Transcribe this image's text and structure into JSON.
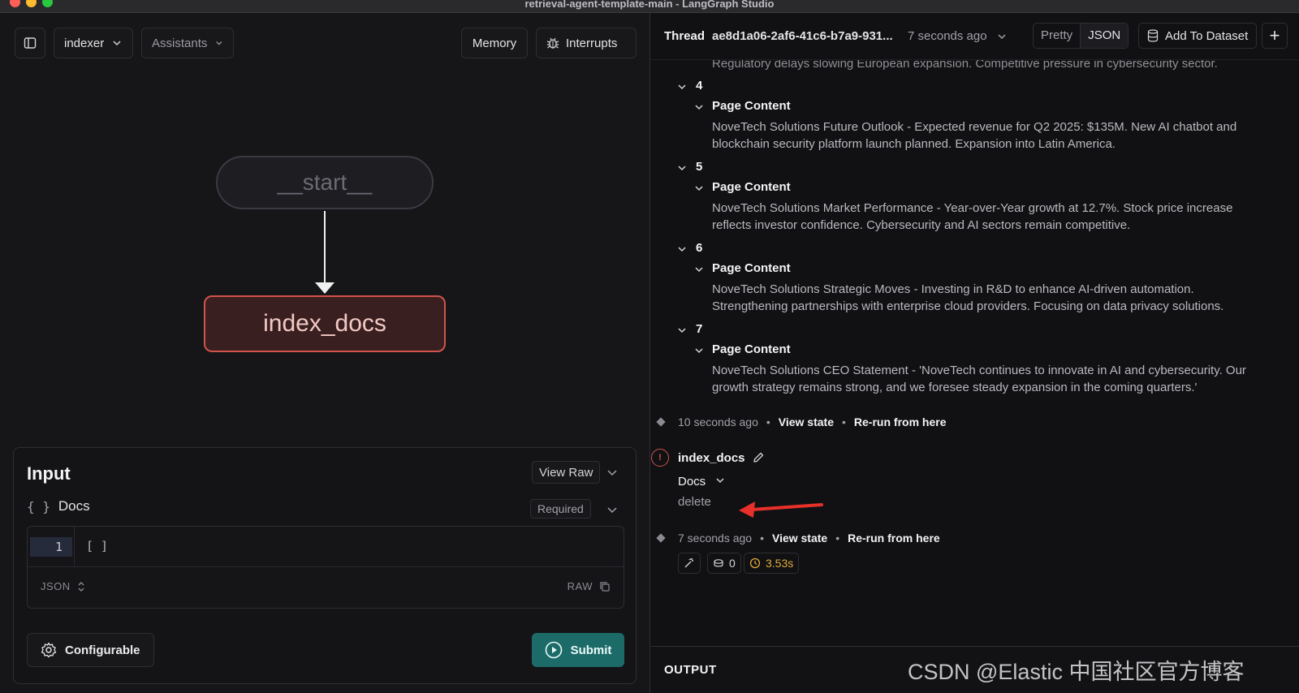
{
  "window": {
    "title": "retrieval-agent-template-main - LangGraph Studio"
  },
  "toolbar": {
    "graph_select": "indexer",
    "assistants_label": "Assistants",
    "memory_label": "Memory",
    "interrupts_label": "Interrupts"
  },
  "graph": {
    "nodes": [
      {
        "label": "__start__",
        "state": "idle"
      },
      {
        "label": "index_docs",
        "state": "error"
      }
    ]
  },
  "input": {
    "title": "Input",
    "view_raw_label": "View Raw",
    "field_label": "Docs",
    "required_label": "Required",
    "line_number": "1",
    "code_value": "[ ]",
    "format_label": "JSON",
    "raw_label": "RAW",
    "configurable_label": "Configurable",
    "submit_label": "Submit"
  },
  "thread": {
    "label": "Thread",
    "id": "ae8d1a06-2af6-41c6-b7a9-931...",
    "time": "7 seconds ago",
    "view_modes": [
      "Pretty",
      "JSON"
    ],
    "selected_view": "JSON",
    "add_dataset_label": "Add To Dataset",
    "truncated_line": "Regulatory delays slowing European expansion. Competitive pressure in cybersecurity sector.",
    "documents": [
      {
        "index": "4",
        "field": "Page Content",
        "text": "NoveTech Solutions Future Outlook - Expected revenue for Q2 2025: $135M. New AI chatbot and blockchain security platform launch planned. Expansion into Latin America."
      },
      {
        "index": "5",
        "field": "Page Content",
        "text": "NoveTech Solutions Market Performance - Year-over-Year growth at 12.7%. Stock price increase reflects investor confidence. Cybersecurity and AI sectors remain competitive."
      },
      {
        "index": "6",
        "field": "Page Content",
        "text": "NoveTech Solutions Strategic Moves - Investing in R&D to enhance AI-driven automation. Strengthening partnerships with enterprise cloud providers. Focusing on data privacy solutions."
      },
      {
        "index": "7",
        "field": "Page Content",
        "text": "NoveTech Solutions CEO Statement - 'NoveTech continues to innovate in AI and cybersecurity. Our growth strategy remains strong, and we foresee steady expansion in the coming quarters.'"
      }
    ],
    "checkpoint1": {
      "time": "10 seconds ago",
      "view_state": "View state",
      "rerun": "Re-run from here"
    },
    "node_run": {
      "name": "index_docs",
      "field": "Docs",
      "value": "delete"
    },
    "checkpoint2": {
      "time": "7 seconds ago",
      "view_state": "View state",
      "rerun": "Re-run from here"
    },
    "stats": {
      "tokens": "0",
      "latency": "3.53s"
    },
    "output_label": "OUTPUT"
  },
  "watermark": "CSDN @Elastic 中国社区官方博客",
  "colors": {
    "accent_submit": "#1c6b68",
    "error": "#d0544b",
    "latency": "#e0a93b",
    "annotation_arrow": "#e8302a"
  }
}
